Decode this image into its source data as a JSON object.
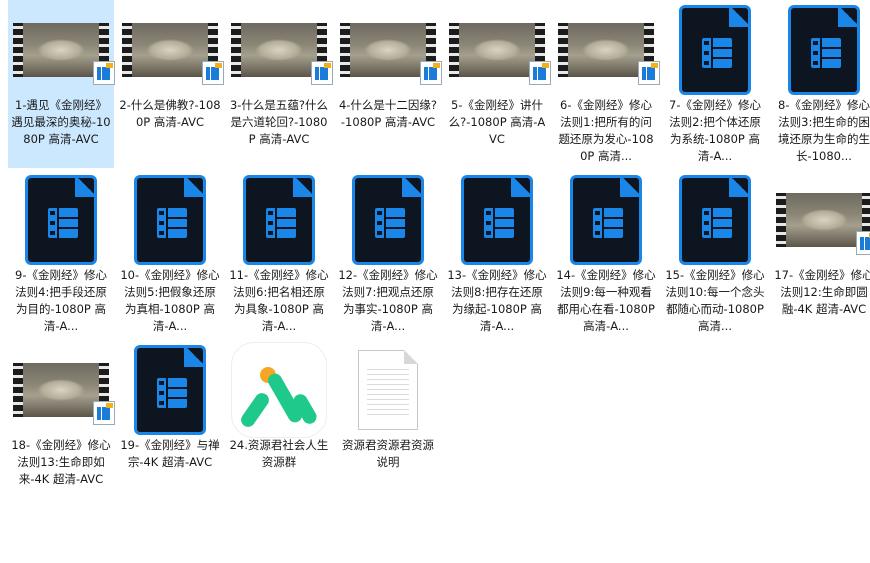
{
  "items": [
    {
      "type": "video-thumb",
      "label": "1-遇见《金刚经》遇见最深的奥秘-1080P 高清-AVC",
      "selected": true
    },
    {
      "type": "video-thumb",
      "label": "2-什么是佛教?-1080P 高清-AVC"
    },
    {
      "type": "video-thumb",
      "label": "3-什么是五蕴?什么是六道轮回?-1080P 高清-AVC"
    },
    {
      "type": "video-thumb",
      "label": "4-什么是十二因缘?-1080P 高清-AVC"
    },
    {
      "type": "video-thumb",
      "label": "5-《金刚经》讲什么?-1080P 高清-AVC"
    },
    {
      "type": "video-thumb",
      "label": "6-《金刚经》修心法则1:把所有的问题还原为发心-1080P 高清..."
    },
    {
      "type": "video-file",
      "label": "7-《金刚经》修心法则2:把个体还原为系统-1080P 高清-A..."
    },
    {
      "type": "video-file",
      "label": "8-《金刚经》修心法则3:把生命的困境还原为生命的生长-1080..."
    },
    {
      "type": "video-file",
      "label": "9-《金刚经》修心法则4:把手段还原为目的-1080P 高清-A..."
    },
    {
      "type": "video-file",
      "label": "10-《金刚经》修心法则5:把假象还原为真相-1080P 高清-A..."
    },
    {
      "type": "video-file",
      "label": "11-《金刚经》修心法则6:把名相还原为具象-1080P 高清-A..."
    },
    {
      "type": "video-file",
      "label": "12-《金刚经》修心法则7:把观点还原为事实-1080P 高清-A..."
    },
    {
      "type": "video-file",
      "label": "13-《金刚经》修心法则8:把存在还原为缘起-1080P 高清-A..."
    },
    {
      "type": "video-file",
      "label": "14-《金刚经》修心法则9:每一种观看都用心在看-1080P 高清-A..."
    },
    {
      "type": "video-file",
      "label": "15-《金刚经》修心法则10:每一个念头都随心而动-1080P 高清..."
    },
    {
      "type": "video-thumb",
      "label": "17-《金刚经》修心法则12:生命即圆融-4K 超清-AVC"
    },
    {
      "type": "video-thumb",
      "label": "18-《金刚经》修心法则13:生命即如来-4K 超清-AVC"
    },
    {
      "type": "video-file",
      "label": "19-《金刚经》与禅宗-4K 超清-AVC"
    },
    {
      "type": "app-icon",
      "label": "24.资源君社会人生资源群"
    },
    {
      "type": "text-file",
      "label": "资源君资源君资源说明"
    }
  ]
}
